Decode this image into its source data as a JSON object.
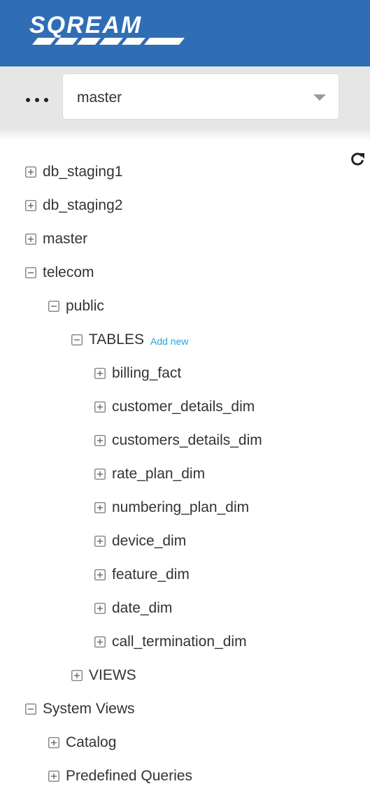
{
  "header": {
    "logo_text": "SQREAM",
    "brand_color": "#2f6db5"
  },
  "toolbar": {
    "menu_icon": "ellipsis-icon",
    "database_select": {
      "value": "master"
    }
  },
  "tree": {
    "refresh_icon": "refresh-icon",
    "nodes": [
      {
        "label": "db_staging1",
        "level": 0,
        "expanded": false
      },
      {
        "label": "db_staging2",
        "level": 0,
        "expanded": false
      },
      {
        "label": "master",
        "level": 0,
        "expanded": false
      },
      {
        "label": "telecom",
        "level": 0,
        "expanded": true
      },
      {
        "label": "public",
        "level": 1,
        "expanded": true
      },
      {
        "label": "TABLES",
        "level": 2,
        "expanded": true,
        "action": "Add new"
      },
      {
        "label": "billing_fact",
        "level": 3,
        "expanded": false
      },
      {
        "label": "customer_details_dim",
        "level": 3,
        "expanded": false
      },
      {
        "label": "customers_details_dim",
        "level": 3,
        "expanded": false
      },
      {
        "label": "rate_plan_dim",
        "level": 3,
        "expanded": false
      },
      {
        "label": "numbering_plan_dim",
        "level": 3,
        "expanded": false
      },
      {
        "label": "device_dim",
        "level": 3,
        "expanded": false
      },
      {
        "label": "feature_dim",
        "level": 3,
        "expanded": false
      },
      {
        "label": "date_dim",
        "level": 3,
        "expanded": false
      },
      {
        "label": "call_termination_dim",
        "level": 3,
        "expanded": false
      },
      {
        "label": "VIEWS",
        "level": 2,
        "expanded": false
      },
      {
        "label": "System Views",
        "level": 0,
        "expanded": true
      },
      {
        "label": "Catalog",
        "level": 1,
        "expanded": false
      },
      {
        "label": "Predefined Queries",
        "level": 1,
        "expanded": false
      }
    ]
  }
}
